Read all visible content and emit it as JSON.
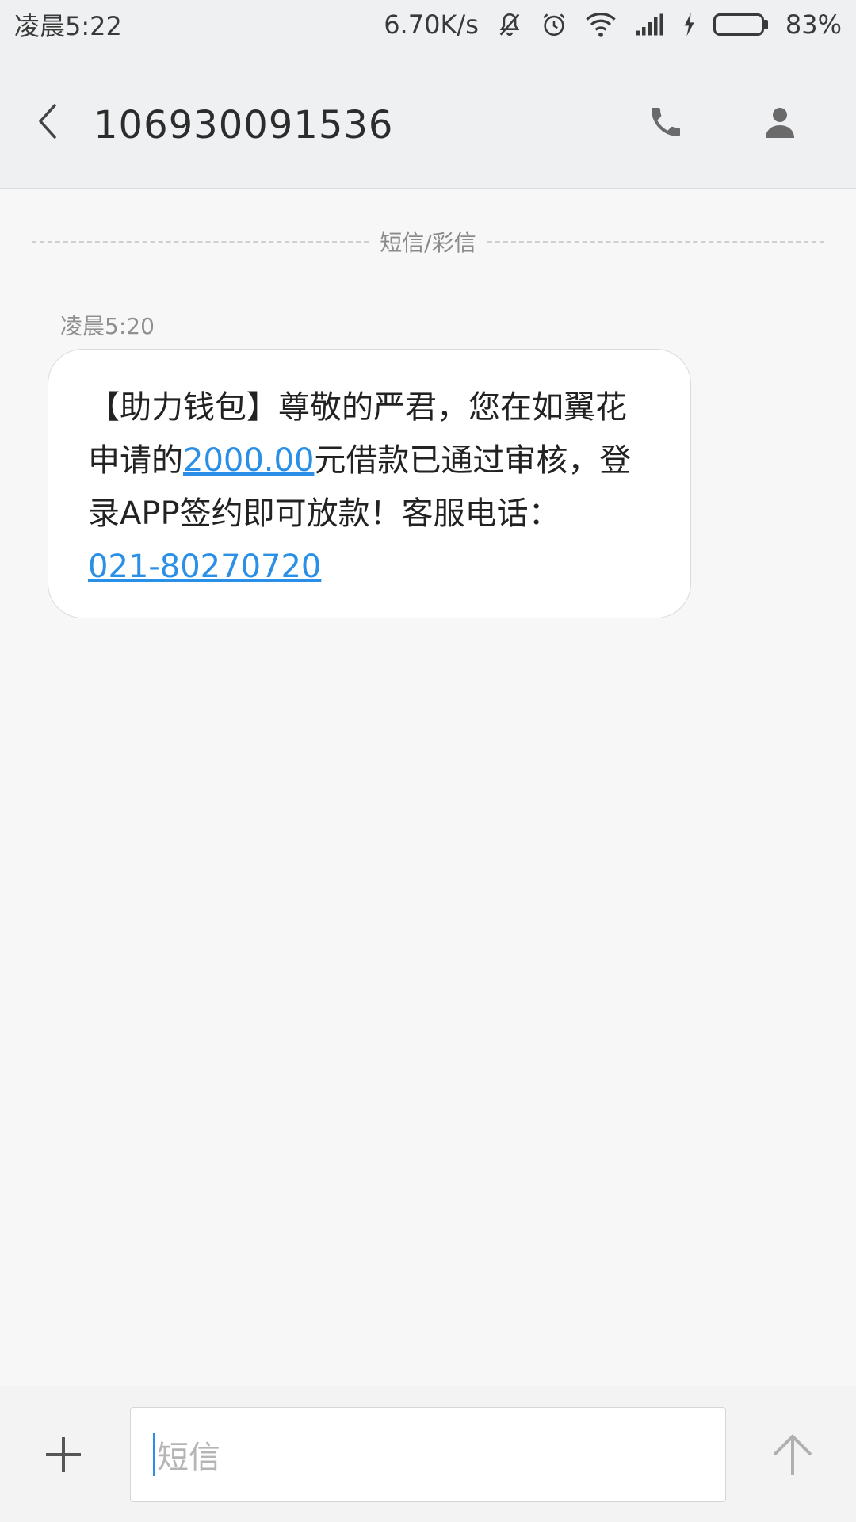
{
  "status_bar": {
    "time": "凌晨5:22",
    "network_speed": "6.70K/s",
    "battery_percent": "83%",
    "battery_level": 0.83,
    "icons": [
      "mute-icon",
      "alarm-icon",
      "wifi-icon",
      "signal-icon",
      "charging-icon",
      "battery-icon"
    ]
  },
  "header": {
    "title": "106930091536",
    "back_icon": "chevron-left-icon",
    "call_icon": "phone-icon",
    "contact_icon": "person-icon"
  },
  "conversation": {
    "divider_label": "短信/彩信",
    "messages": [
      {
        "time": "凌晨5:20",
        "text_part1": "【助力钱包】尊敬的严君，您在如翼花申请的",
        "amount_link": "2000.00",
        "text_part2": "元借款已通过审核，登录APP签约即可放款！客服电话：",
        "phone_link": "021-80270720"
      }
    ]
  },
  "composer": {
    "placeholder": "短信",
    "add_icon": "plus-icon",
    "send_icon": "arrow-up-icon"
  }
}
